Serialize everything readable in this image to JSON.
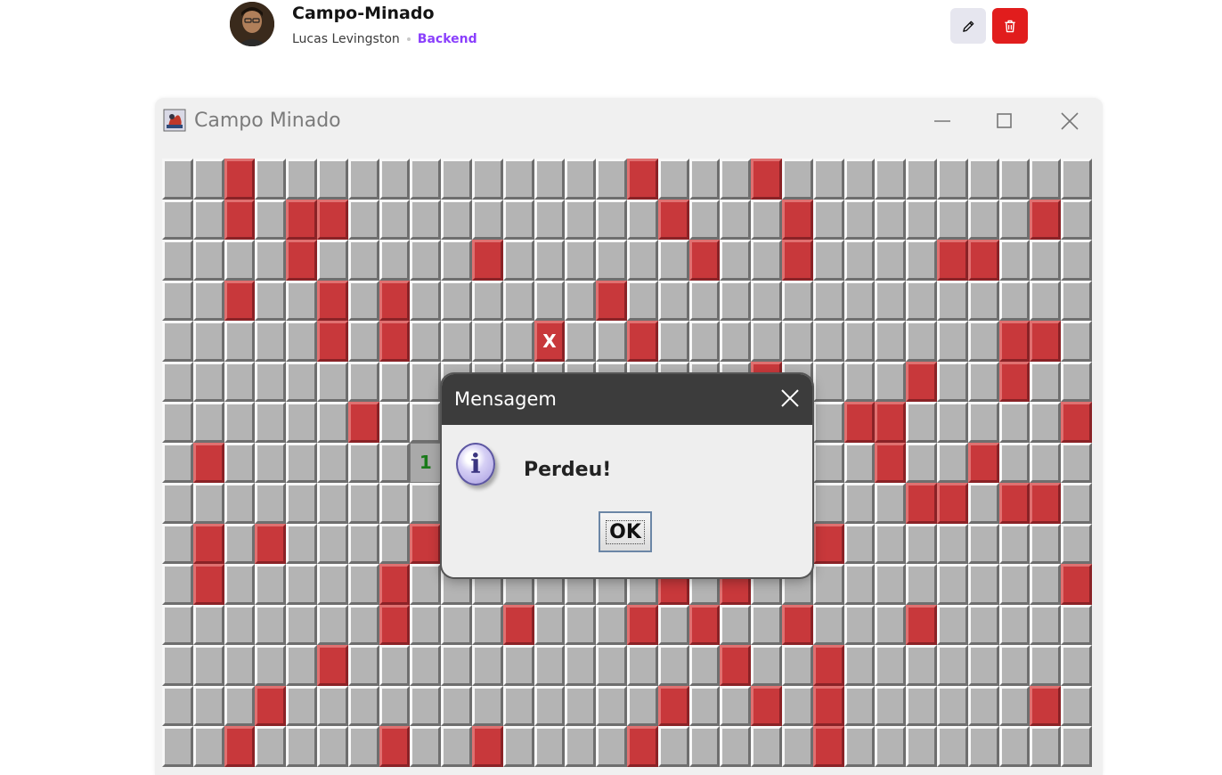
{
  "post": {
    "title": "Campo-Minado",
    "author": "Lucas Levingston",
    "category": "Backend",
    "category_color": "#8a3ffc",
    "actions": [
      {
        "name": "edit-button",
        "icon": "pencil-icon"
      },
      {
        "name": "delete-button",
        "icon": "trash-icon",
        "color": "#e11d1d"
      }
    ]
  },
  "window": {
    "title": "Campo Minado",
    "controls": [
      "minimize-icon",
      "maximize-icon",
      "close-icon"
    ]
  },
  "board": {
    "columns": 30,
    "rows": 15,
    "mine_color": "#c8383b",
    "cell_color": "#b4b4b4",
    "mines": [
      [
        0,
        2
      ],
      [
        0,
        15
      ],
      [
        0,
        19
      ],
      [
        1,
        2
      ],
      [
        1,
        4
      ],
      [
        1,
        5
      ],
      [
        1,
        16
      ],
      [
        1,
        20
      ],
      [
        1,
        28
      ],
      [
        2,
        4
      ],
      [
        2,
        10
      ],
      [
        2,
        17
      ],
      [
        2,
        20
      ],
      [
        2,
        25
      ],
      [
        2,
        26
      ],
      [
        3,
        2
      ],
      [
        3,
        5
      ],
      [
        3,
        7
      ],
      [
        3,
        14
      ],
      [
        4,
        5
      ],
      [
        4,
        7
      ],
      [
        4,
        12
      ],
      [
        4,
        15
      ],
      [
        4,
        27
      ],
      [
        4,
        28
      ],
      [
        5,
        19
      ],
      [
        5,
        24
      ],
      [
        5,
        27
      ],
      [
        6,
        6
      ],
      [
        6,
        22
      ],
      [
        6,
        23
      ],
      [
        6,
        29
      ],
      [
        7,
        1
      ],
      [
        7,
        23
      ],
      [
        7,
        26
      ],
      [
        8,
        24
      ],
      [
        8,
        25
      ],
      [
        8,
        27
      ],
      [
        8,
        28
      ],
      [
        9,
        1
      ],
      [
        9,
        3
      ],
      [
        9,
        8
      ],
      [
        9,
        21
      ],
      [
        10,
        1
      ],
      [
        10,
        7
      ],
      [
        10,
        16
      ],
      [
        10,
        18
      ],
      [
        10,
        29
      ],
      [
        11,
        7
      ],
      [
        11,
        11
      ],
      [
        11,
        15
      ],
      [
        11,
        17
      ],
      [
        11,
        20
      ],
      [
        11,
        24
      ],
      [
        12,
        5
      ],
      [
        12,
        18
      ],
      [
        12,
        21
      ],
      [
        13,
        3
      ],
      [
        13,
        16
      ],
      [
        13,
        19
      ],
      [
        13,
        21
      ],
      [
        13,
        28
      ],
      [
        14,
        2
      ],
      [
        14,
        7
      ],
      [
        14,
        10
      ],
      [
        14,
        15
      ],
      [
        14,
        21
      ]
    ],
    "exploded": {
      "row": 4,
      "col": 12,
      "label": "X"
    },
    "revealed": [
      {
        "row": 7,
        "col": 8,
        "label": "1"
      }
    ]
  },
  "dialog": {
    "title": "Mensagem",
    "icon": "info-icon",
    "icon_glyph": "i",
    "message": "Perdeu!",
    "ok_label": "OK"
  }
}
